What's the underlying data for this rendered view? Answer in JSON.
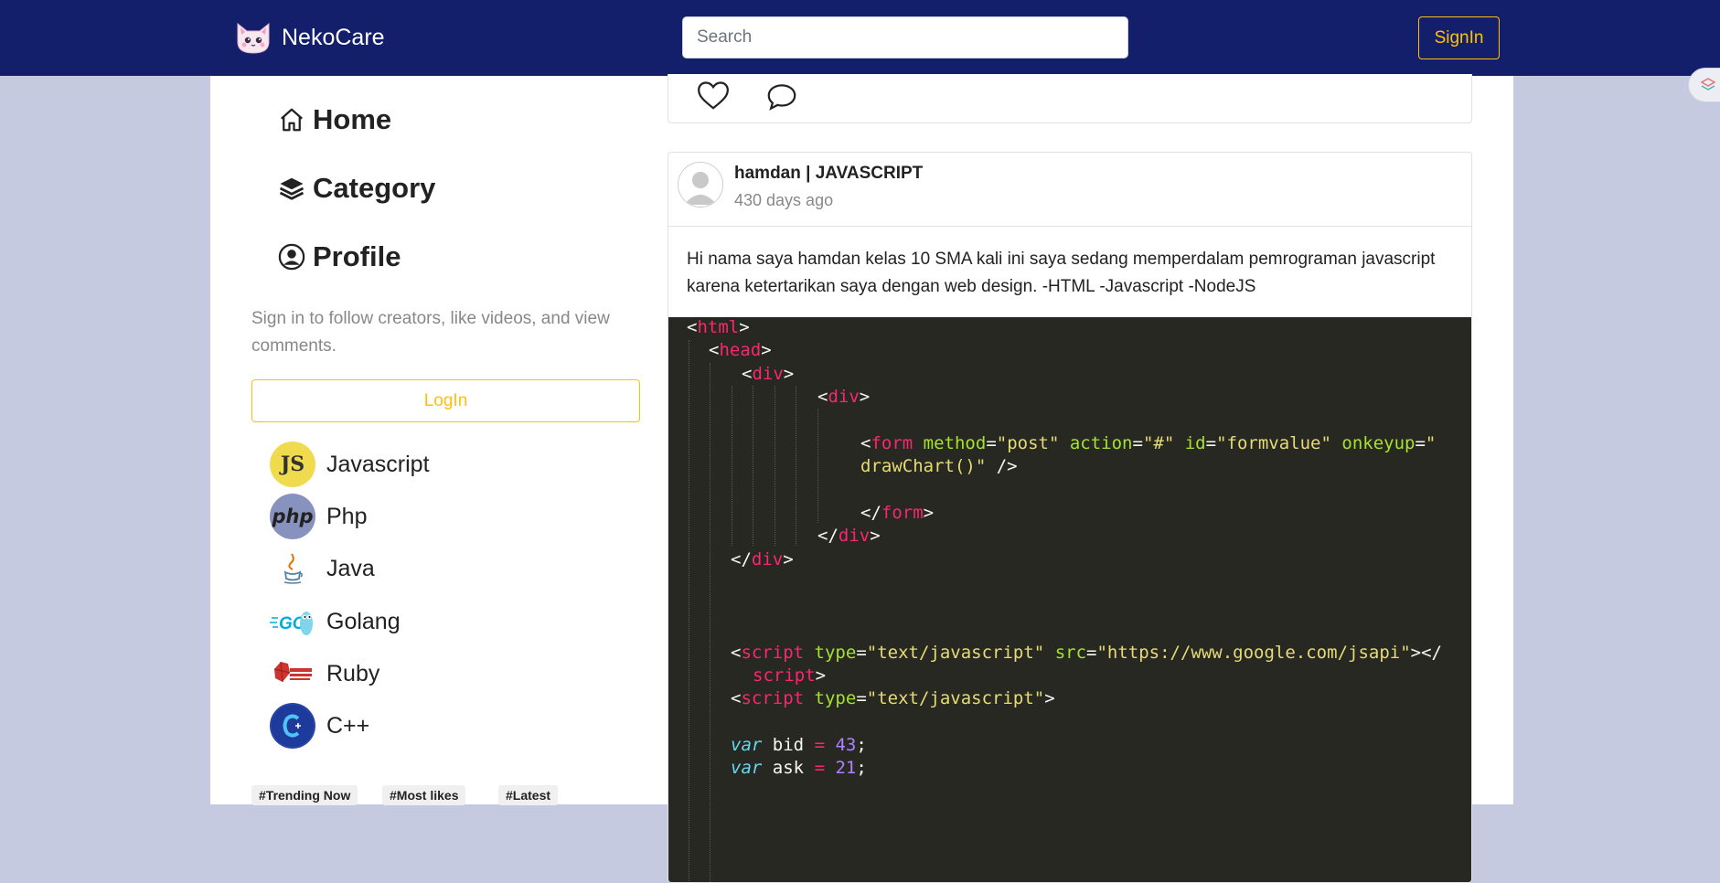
{
  "header": {
    "brand_name": "NekoCare",
    "search_placeholder": "Search",
    "signin_label": "SignIn"
  },
  "sidebar": {
    "nav": [
      {
        "label": "Home",
        "icon": "home-icon"
      },
      {
        "label": "Category",
        "icon": "layers-icon"
      },
      {
        "label": "Profile",
        "icon": "user-circle-icon"
      }
    ],
    "hint": "Sign in to follow creators, like videos, and view comments.",
    "login_label": "LogIn",
    "categories": [
      {
        "name": "Javascript",
        "icon": "javascript-logo-icon"
      },
      {
        "name": "Php",
        "icon": "php-logo-icon"
      },
      {
        "name": "Java",
        "icon": "java-logo-icon"
      },
      {
        "name": "Golang",
        "icon": "golang-logo-icon"
      },
      {
        "name": "Ruby",
        "icon": "ruby-logo-icon"
      },
      {
        "name": "C++",
        "icon": "cpp-logo-icon"
      }
    ],
    "tags": [
      "#Trending Now",
      "#Most likes",
      "#Latest"
    ]
  },
  "post": {
    "author": "hamdan | JAVASCRIPT",
    "time": "430 days ago",
    "text": "Hi nama saya hamdan kelas 10 SMA kali ini saya sedang memperdalam pemrograman javascript karena ketertarikan saya dengan web design. -HTML -Javascript -NodeJS",
    "code": {
      "l1_tag": "html",
      "l2_tag": "head",
      "l3_tag": "div",
      "l4_tag": "div",
      "l5_tag": "form",
      "l5_attr1": "method",
      "l5_val1": "\"post\"",
      "l5_attr2": "action",
      "l5_val2": "\"#\"",
      "l5_attr3": "id",
      "l5_val3": "\"formvalue\"",
      "l5_attr4": "onkeyup",
      "l5_val4a": "\"",
      "l6_val4b": "drawChart()\"",
      "l7_tag": "form",
      "l8_tag": "div",
      "l9_tag": "div",
      "l10_tag": "script",
      "l10_attr1": "type",
      "l10_val1": "\"text/javascript\"",
      "l10_attr2": "src",
      "l10_val2": "\"https://www.google.com/jsapi\"",
      "l11_tag": "script",
      "l12_tag": "script",
      "l12_attr1": "type",
      "l12_val1": "\"text/javascript\"",
      "l13_kw": "var",
      "l13_name": "bid",
      "l13_num": "43",
      "l14_kw": "var",
      "l14_name": "ask",
      "l14_num": "21"
    }
  },
  "colors": {
    "header_bg": "#141f6b",
    "accent": "#ffc107",
    "page_bg": "#c5cae0",
    "code_bg": "#272822"
  }
}
